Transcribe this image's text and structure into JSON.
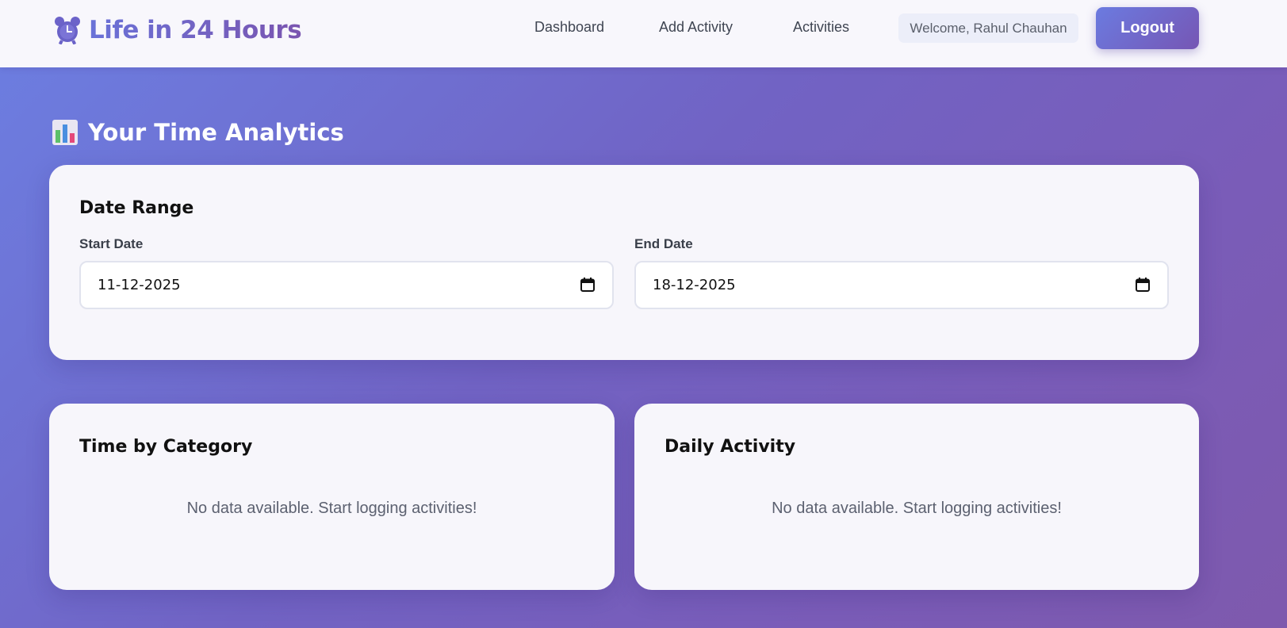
{
  "header": {
    "brand": "Life in 24 Hours",
    "nav": {
      "dashboard": "Dashboard",
      "add_activity": "Add Activity",
      "activities": "Activities"
    },
    "welcome": "Welcome, Rahul Chauhan",
    "logout": "Logout"
  },
  "page": {
    "title": "Your Time Analytics"
  },
  "date_range": {
    "title": "Date Range",
    "start_label": "Start Date",
    "start_value": "11-12-2025",
    "end_label": "End Date",
    "end_value": "18-12-2025"
  },
  "cards": {
    "category": {
      "title": "Time by Category",
      "empty": "No data available. Start logging activities!"
    },
    "daily": {
      "title": "Daily Activity",
      "empty": "No data available. Start logging activities!"
    }
  },
  "icons": {
    "brand": "alarm-clock-icon",
    "heading": "bar-chart-icon",
    "calendar": "calendar-icon"
  },
  "colors": {
    "accent_start": "#6b7be0",
    "accent_end": "#7656b4"
  }
}
